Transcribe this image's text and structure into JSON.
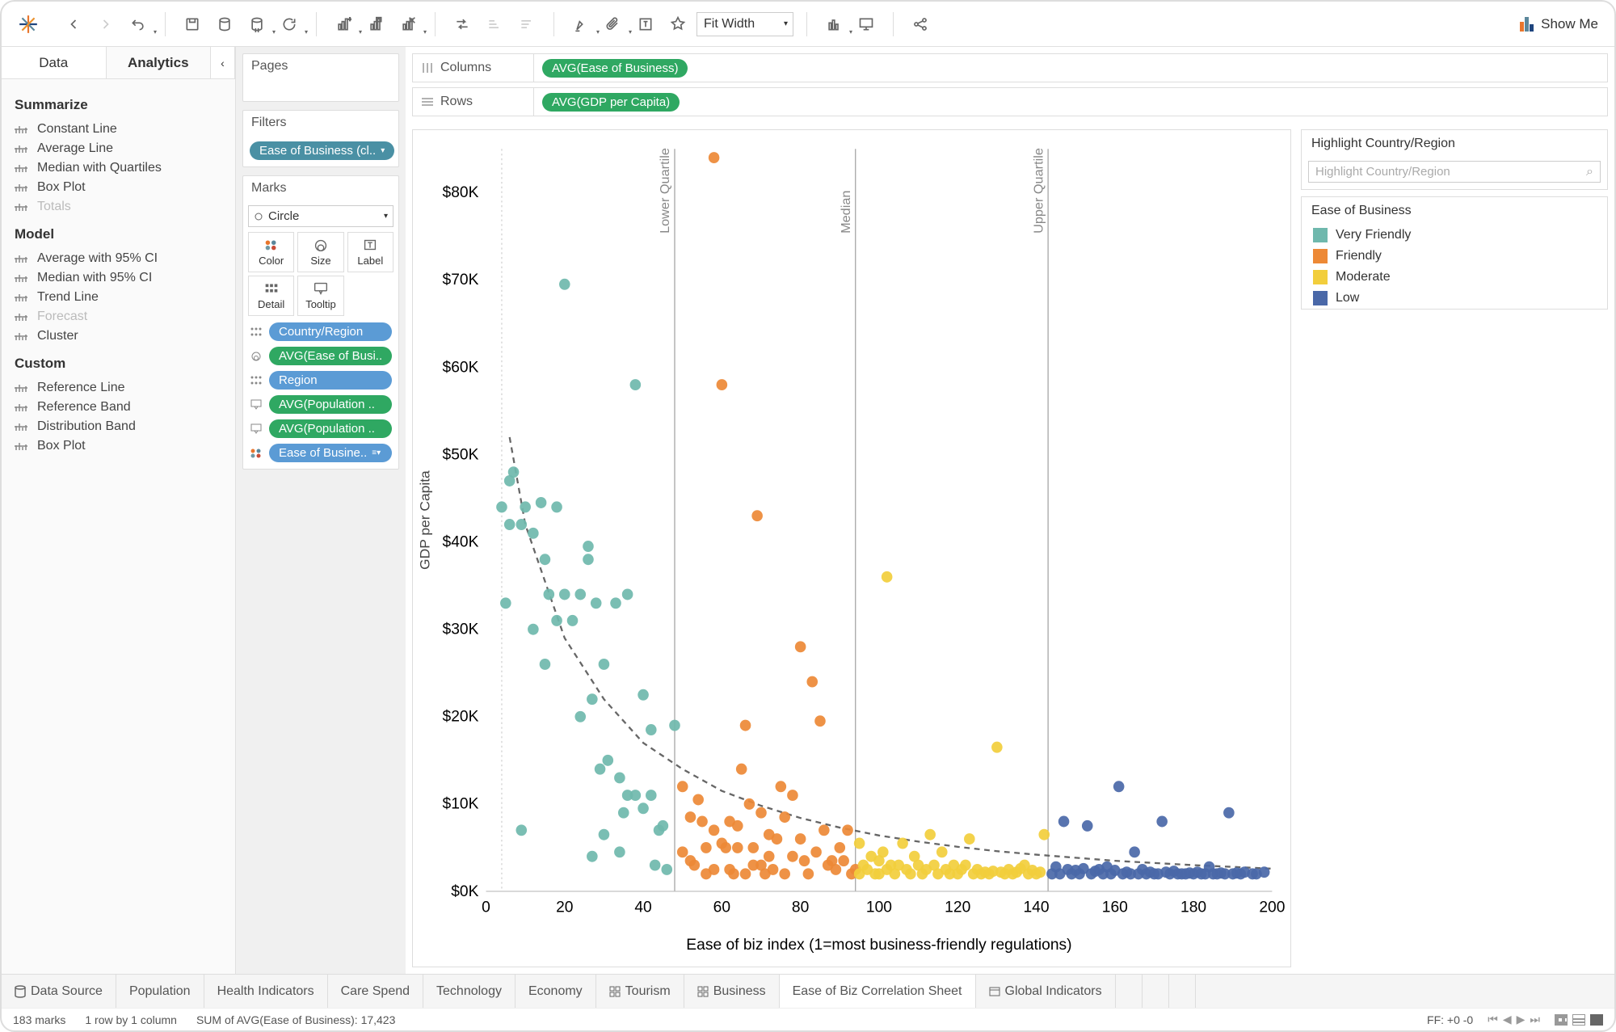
{
  "toolbar": {
    "fit_mode": "Fit Width",
    "show_me": "Show Me"
  },
  "left_tabs": {
    "data": "Data",
    "analytics": "Analytics"
  },
  "analytics": {
    "summarize": {
      "heading": "Summarize",
      "items": [
        "Constant Line",
        "Average Line",
        "Median with Quartiles",
        "Box Plot",
        "Totals"
      ]
    },
    "model": {
      "heading": "Model",
      "items": [
        "Average with 95% CI",
        "Median with 95% CI",
        "Trend Line",
        "Forecast",
        "Cluster"
      ]
    },
    "custom": {
      "heading": "Custom",
      "items": [
        "Reference Line",
        "Reference Band",
        "Distribution Band",
        "Box Plot"
      ]
    }
  },
  "cards": {
    "pages": "Pages",
    "filters": "Filters",
    "filter_pill": "Ease of Business (cl..",
    "marks": "Marks",
    "marks_type": "Circle",
    "cells": {
      "color": "Color",
      "size": "Size",
      "label": "Label",
      "detail": "Detail",
      "tooltip": "Tooltip"
    },
    "rows": [
      {
        "label": "Country/Region",
        "color": "blue"
      },
      {
        "label": "AVG(Ease of Busi..",
        "color": "green"
      },
      {
        "label": "Region",
        "color": "blue"
      },
      {
        "label": "AVG(Population ..",
        "color": "green"
      },
      {
        "label": "AVG(Population ..",
        "color": "green"
      },
      {
        "label": "Ease of Busine..",
        "color": "blue"
      }
    ]
  },
  "shelves": {
    "columns_label": "Columns",
    "columns_pill": "AVG(Ease of Business)",
    "rows_label": "Rows",
    "rows_pill": "AVG(GDP per Capita)"
  },
  "highlight": {
    "title": "Highlight Country/Region",
    "placeholder": "Highlight Country/Region"
  },
  "legend": {
    "title": "Ease of Business",
    "items": [
      {
        "label": "Very Friendly",
        "color": "#6fb8ad"
      },
      {
        "label": "Friendly",
        "color": "#ed8936"
      },
      {
        "label": "Moderate",
        "color": "#f2ce3c"
      },
      {
        "label": "Low",
        "color": "#4a68a8"
      }
    ]
  },
  "bottom_tabs": [
    "Data Source",
    "Population",
    "Health Indicators",
    "Care Spend",
    "Technology",
    "Economy",
    "Tourism",
    "Business",
    "Ease of Biz Correlation Sheet",
    "Global Indicators"
  ],
  "status": {
    "marks": "183 marks",
    "layout": "1 row by 1 column",
    "sum": "SUM of AVG(Ease of Business): 17,423",
    "ff": "FF: +0 -0"
  },
  "chart_data": {
    "type": "scatter",
    "title": "",
    "xlabel": "Ease of biz index (1=most business-friendly regulations)",
    "ylabel": "GDP per Capita",
    "xlim": [
      0,
      200
    ],
    "ylim": [
      0,
      85000
    ],
    "yticks": [
      0,
      10000,
      20000,
      30000,
      40000,
      50000,
      60000,
      70000,
      80000
    ],
    "ytick_labels": [
      "$0K",
      "$10K",
      "$20K",
      "$30K",
      "$40K",
      "$50K",
      "$60K",
      "$70K",
      "$80K"
    ],
    "xticks": [
      0,
      20,
      40,
      60,
      80,
      100,
      120,
      140,
      160,
      180,
      200
    ],
    "reference_lines": [
      {
        "label": "Lower Quartile",
        "x": 48
      },
      {
        "label": "Median",
        "x": 94
      },
      {
        "label": "Upper Quartile",
        "x": 143
      }
    ],
    "trend_curve": [
      [
        6,
        52000
      ],
      [
        10,
        42000
      ],
      [
        20,
        29000
      ],
      [
        30,
        22000
      ],
      [
        40,
        17000
      ],
      [
        50,
        14000
      ],
      [
        60,
        11500
      ],
      [
        70,
        9800
      ],
      [
        80,
        8400
      ],
      [
        90,
        7300
      ],
      [
        100,
        6400
      ],
      [
        110,
        5700
      ],
      [
        120,
        5100
      ],
      [
        130,
        4600
      ],
      [
        140,
        4200
      ],
      [
        160,
        3500
      ],
      [
        180,
        3000
      ],
      [
        200,
        2600
      ]
    ],
    "series": [
      {
        "name": "Very Friendly",
        "color": "#6fb8ad",
        "points": [
          [
            4,
            44000
          ],
          [
            5,
            33000
          ],
          [
            6,
            42000
          ],
          [
            6,
            47000
          ],
          [
            7,
            48000
          ],
          [
            9,
            42000
          ],
          [
            9,
            7000
          ],
          [
            10,
            44000
          ],
          [
            12,
            41000
          ],
          [
            12,
            30000
          ],
          [
            14,
            44500
          ],
          [
            15,
            26000
          ],
          [
            15,
            38000
          ],
          [
            16,
            34000
          ],
          [
            18,
            31000
          ],
          [
            18,
            44000
          ],
          [
            20,
            34000
          ],
          [
            20,
            69500
          ],
          [
            22,
            31000
          ],
          [
            24,
            20000
          ],
          [
            24,
            34000
          ],
          [
            26,
            39500
          ],
          [
            26,
            38000
          ],
          [
            27,
            22000
          ],
          [
            27,
            4000
          ],
          [
            28,
            33000
          ],
          [
            29,
            14000
          ],
          [
            30,
            26000
          ],
          [
            30,
            6500
          ],
          [
            31,
            15000
          ],
          [
            33,
            33000
          ],
          [
            34,
            13000
          ],
          [
            34,
            4500
          ],
          [
            35,
            9000
          ],
          [
            36,
            11000
          ],
          [
            36,
            34000
          ],
          [
            38,
            11000
          ],
          [
            38,
            58000
          ],
          [
            40,
            22500
          ],
          [
            40,
            9500
          ],
          [
            42,
            18500
          ],
          [
            42,
            11000
          ],
          [
            43,
            3000
          ],
          [
            44,
            7000
          ],
          [
            45,
            7500
          ],
          [
            46,
            2500
          ],
          [
            48,
            19000
          ]
        ]
      },
      {
        "name": "Friendly",
        "color": "#ed8936",
        "points": [
          [
            50,
            12000
          ],
          [
            50,
            4500
          ],
          [
            52,
            8500
          ],
          [
            52,
            3500
          ],
          [
            53,
            3000
          ],
          [
            54,
            10500
          ],
          [
            55,
            8000
          ],
          [
            56,
            5000
          ],
          [
            56,
            2000
          ],
          [
            58,
            84000
          ],
          [
            58,
            7000
          ],
          [
            58,
            2500
          ],
          [
            60,
            5500
          ],
          [
            60,
            58000
          ],
          [
            61,
            5000
          ],
          [
            62,
            8000
          ],
          [
            62,
            2500
          ],
          [
            63,
            2000
          ],
          [
            64,
            5000
          ],
          [
            64,
            7500
          ],
          [
            65,
            14000
          ],
          [
            66,
            19000
          ],
          [
            66,
            2000
          ],
          [
            67,
            10000
          ],
          [
            68,
            5000
          ],
          [
            68,
            3000
          ],
          [
            69,
            43000
          ],
          [
            70,
            9000
          ],
          [
            70,
            3000
          ],
          [
            71,
            2000
          ],
          [
            72,
            6500
          ],
          [
            72,
            4000
          ],
          [
            73,
            2500
          ],
          [
            74,
            6000
          ],
          [
            75,
            12000
          ],
          [
            76,
            8500
          ],
          [
            76,
            2000
          ],
          [
            78,
            4000
          ],
          [
            78,
            11000
          ],
          [
            80,
            6000
          ],
          [
            80,
            28000
          ],
          [
            81,
            3500
          ],
          [
            82,
            2000
          ],
          [
            83,
            24000
          ],
          [
            84,
            4500
          ],
          [
            85,
            19500
          ],
          [
            86,
            7000
          ],
          [
            87,
            3000
          ],
          [
            88,
            3500
          ],
          [
            89,
            2500
          ],
          [
            90,
            5000
          ],
          [
            91,
            3500
          ],
          [
            92,
            7000
          ],
          [
            93,
            2000
          ],
          [
            94,
            2500
          ]
        ]
      },
      {
        "name": "Moderate",
        "color": "#f2ce3c",
        "points": [
          [
            95,
            2000
          ],
          [
            95,
            5500
          ],
          [
            96,
            3000
          ],
          [
            97,
            2500
          ],
          [
            98,
            4000
          ],
          [
            99,
            2000
          ],
          [
            100,
            3500
          ],
          [
            100,
            2000
          ],
          [
            101,
            4500
          ],
          [
            102,
            36000
          ],
          [
            102,
            2500
          ],
          [
            103,
            3000
          ],
          [
            104,
            2000
          ],
          [
            105,
            3000
          ],
          [
            106,
            5500
          ],
          [
            107,
            2500
          ],
          [
            108,
            2000
          ],
          [
            109,
            4000
          ],
          [
            110,
            3000
          ],
          [
            111,
            2000
          ],
          [
            112,
            2500
          ],
          [
            113,
            6500
          ],
          [
            114,
            3000
          ],
          [
            115,
            2000
          ],
          [
            116,
            4500
          ],
          [
            117,
            2500
          ],
          [
            118,
            2000
          ],
          [
            119,
            3000
          ],
          [
            120,
            2000
          ],
          [
            121,
            2500
          ],
          [
            122,
            3000
          ],
          [
            123,
            6000
          ],
          [
            124,
            2000
          ],
          [
            125,
            2500
          ],
          [
            126,
            2000
          ],
          [
            127,
            2200
          ],
          [
            128,
            2000
          ],
          [
            129,
            2300
          ],
          [
            130,
            16500
          ],
          [
            131,
            2200
          ],
          [
            132,
            2000
          ],
          [
            133,
            2500
          ],
          [
            134,
            2000
          ],
          [
            135,
            2200
          ],
          [
            136,
            2600
          ],
          [
            137,
            3000
          ],
          [
            138,
            2000
          ],
          [
            139,
            2400
          ],
          [
            140,
            2000
          ],
          [
            141,
            2200
          ],
          [
            142,
            6500
          ]
        ]
      },
      {
        "name": "Low",
        "color": "#4a68a8",
        "points": [
          [
            144,
            2000
          ],
          [
            145,
            2800
          ],
          [
            146,
            2000
          ],
          [
            147,
            8000
          ],
          [
            148,
            2500
          ],
          [
            149,
            2000
          ],
          [
            150,
            2400
          ],
          [
            151,
            2000
          ],
          [
            152,
            2600
          ],
          [
            153,
            7500
          ],
          [
            154,
            2000
          ],
          [
            155,
            2300
          ],
          [
            156,
            2500
          ],
          [
            157,
            2000
          ],
          [
            158,
            2800
          ],
          [
            159,
            2000
          ],
          [
            160,
            2400
          ],
          [
            161,
            12000
          ],
          [
            162,
            2000
          ],
          [
            163,
            2200
          ],
          [
            164,
            2000
          ],
          [
            165,
            4500
          ],
          [
            166,
            2000
          ],
          [
            167,
            2500
          ],
          [
            168,
            2000
          ],
          [
            169,
            2200
          ],
          [
            170,
            2000
          ],
          [
            171,
            2000
          ],
          [
            172,
            8000
          ],
          [
            173,
            2200
          ],
          [
            174,
            2000
          ],
          [
            175,
            2300
          ],
          [
            176,
            2000
          ],
          [
            177,
            2000
          ],
          [
            178,
            2000
          ],
          [
            179,
            2100
          ],
          [
            180,
            2000
          ],
          [
            181,
            2200
          ],
          [
            182,
            2000
          ],
          [
            183,
            2000
          ],
          [
            184,
            2800
          ],
          [
            185,
            2000
          ],
          [
            186,
            2000
          ],
          [
            187,
            2100
          ],
          [
            188,
            2000
          ],
          [
            189,
            9000
          ],
          [
            190,
            2000
          ],
          [
            191,
            2100
          ],
          [
            192,
            2000
          ],
          [
            193,
            2200
          ],
          [
            195,
            2000
          ],
          [
            196,
            2000
          ],
          [
            198,
            2200
          ]
        ]
      }
    ]
  }
}
